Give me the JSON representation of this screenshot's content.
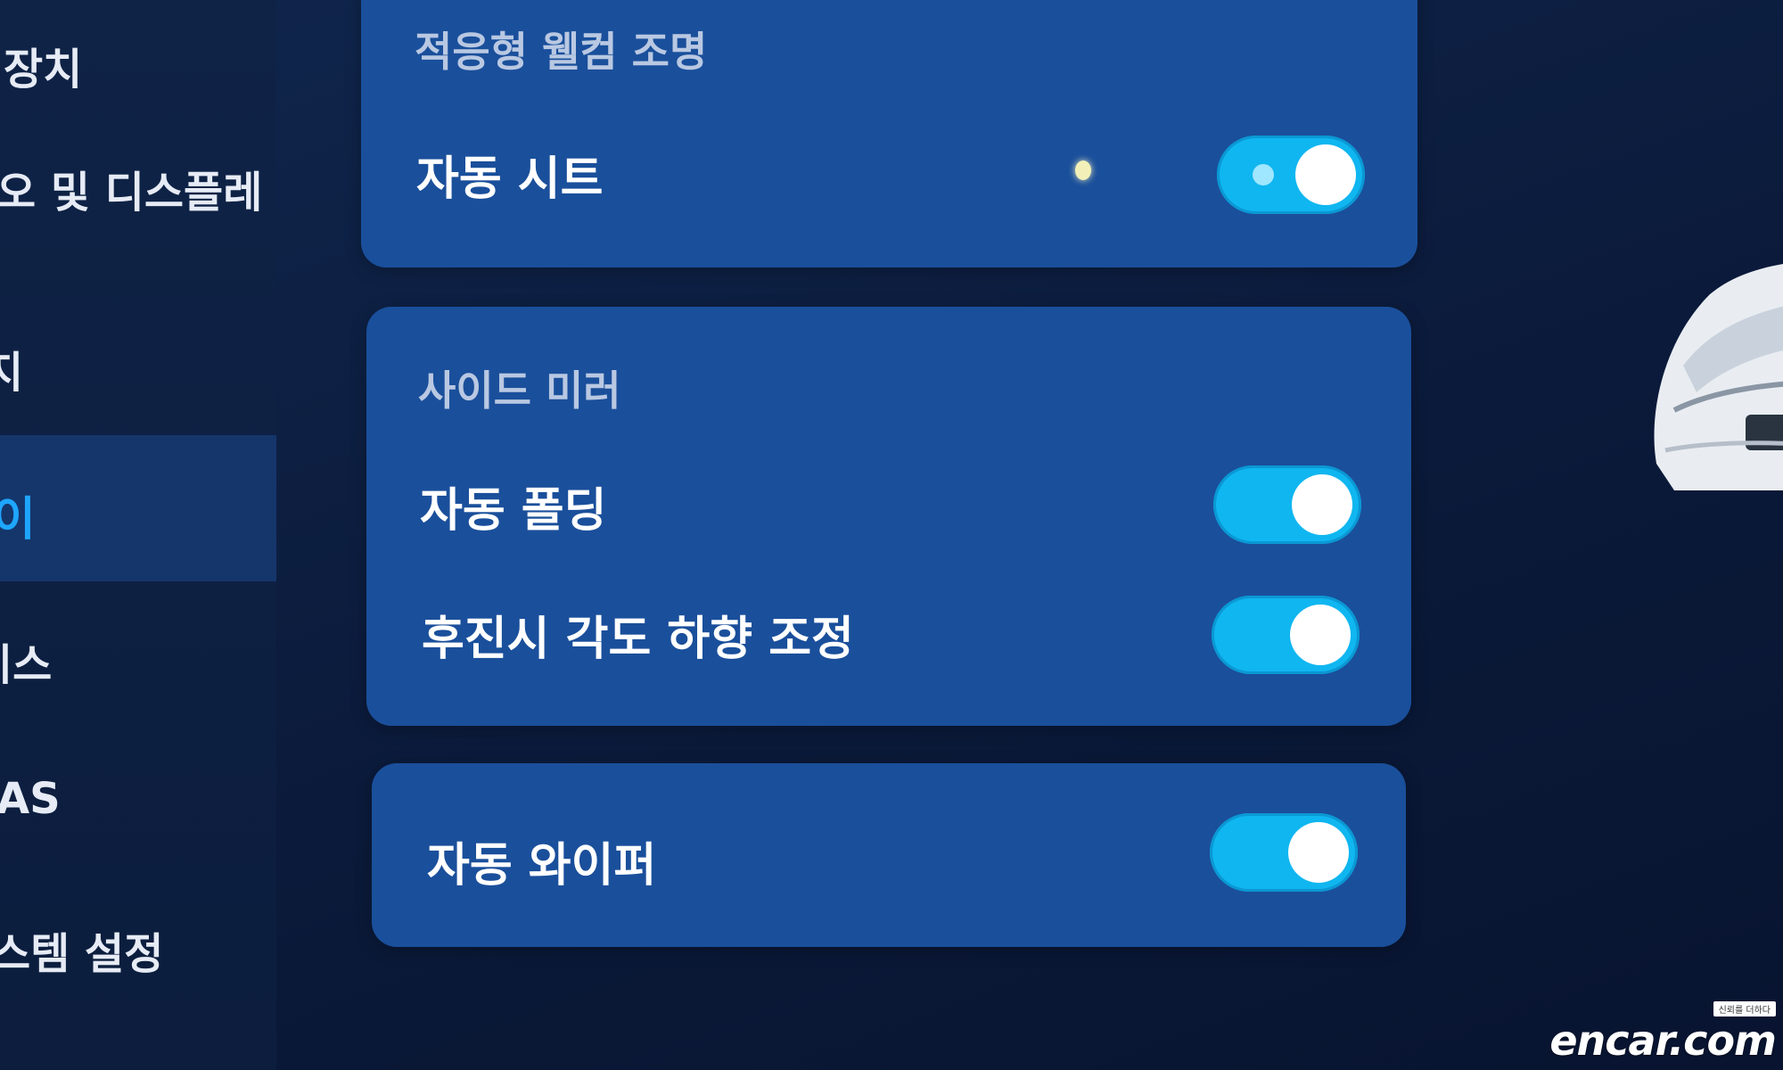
{
  "sidebar": {
    "items": [
      {
        "label": "장치"
      },
      {
        "label": "오 및 디스플레"
      },
      {
        "label": "지"
      },
      {
        "label": "이"
      },
      {
        "label": "비스"
      },
      {
        "label": "AS"
      },
      {
        "label": "스템 설정"
      }
    ]
  },
  "welcome_section": {
    "title": "적응형 웰컴 조명",
    "auto_seat": {
      "label": "자동 시트",
      "on": true
    }
  },
  "mirror_section": {
    "title": "사이드 미러",
    "auto_folding": {
      "label": "자동 폴딩",
      "on": true
    },
    "reverse_tilt": {
      "label": "후진시 각도 하향 조정",
      "on": true
    }
  },
  "wiper_section": {
    "auto_wiper": {
      "label": "자동 와이퍼",
      "on": true
    }
  },
  "watermark": {
    "tagline": "신뢰를 더하다",
    "brand": "encar.com"
  },
  "colors": {
    "background": "#0c1a36",
    "card": "#1a4f9b",
    "toggle_on": "#10b6f0",
    "sidebar_active": "#15366b",
    "sidebar_active_text": "#1ea6ff"
  }
}
